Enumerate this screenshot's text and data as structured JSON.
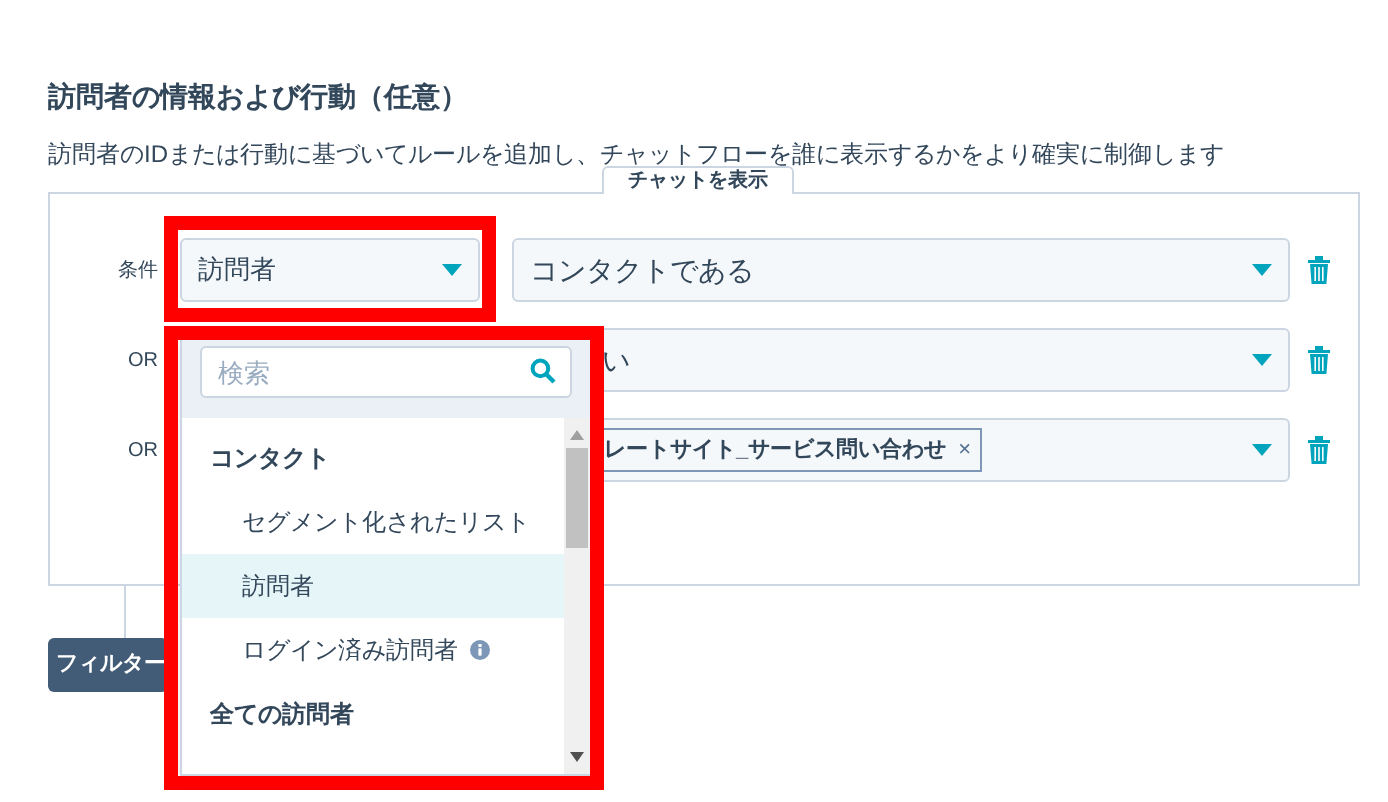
{
  "section": {
    "title": "訪問者の情報および行動（任意）",
    "description": "訪問者のIDまたは行動に基づいてルールを追加し、チャットフローを誰に表示するかをより確実に制御します"
  },
  "tab": {
    "label": "チャットを表示"
  },
  "rules": [
    {
      "label": "条件",
      "field": "訪問者",
      "kind": "text",
      "value": "コンタクトである"
    },
    {
      "label": "OR",
      "kind": "text",
      "value": "い"
    },
    {
      "label": "OR",
      "kind": "tag",
      "value": "レートサイト_サービス問い合わせ",
      "remove": "×"
    }
  ],
  "filter_button": {
    "label": "フィルター"
  },
  "dropdown": {
    "search": {
      "placeholder": "検索"
    },
    "groups": [
      {
        "label": "コンタクト",
        "items": [
          {
            "label": "セグメント化されたリスト",
            "selected": false,
            "info": false
          },
          {
            "label": "訪問者",
            "selected": true,
            "info": false
          },
          {
            "label": "ログイン済み訪問者",
            "selected": false,
            "info": true
          }
        ]
      },
      {
        "label": "全ての訪問者"
      }
    ]
  }
}
